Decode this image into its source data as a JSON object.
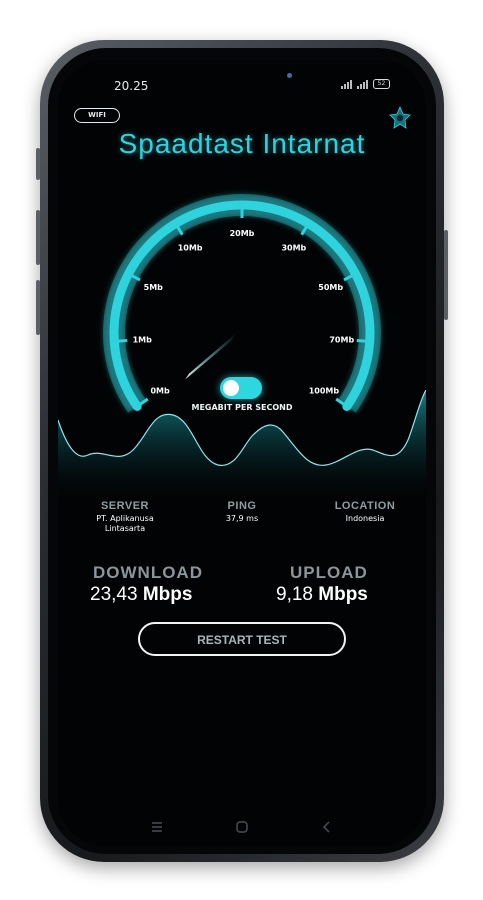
{
  "status_bar": {
    "time": "20.25",
    "battery": "52"
  },
  "header": {
    "network_badge": "WIFI",
    "title": "Spaadtast Intarnat",
    "settings_icon": "gear-icon"
  },
  "gauge": {
    "ticks": [
      "0Mb",
      "1Mb",
      "5Mb",
      "10Mb",
      "20Mb",
      "30Mb",
      "50Mb",
      "70Mb",
      "100Mb"
    ],
    "unit_label": "MEGABIT PER SECOND",
    "needle_value_mb": 0.7,
    "accent_color": "#2fd3de",
    "toggle_on": true
  },
  "info": {
    "server": {
      "label": "SERVER",
      "value_line1": "PT. Aplikanusa",
      "value_line2": "Lintasarta"
    },
    "ping": {
      "label": "PING",
      "value": "37,9 ms"
    },
    "location": {
      "label": "LOCATION",
      "value": "Indonesia"
    }
  },
  "results": {
    "download": {
      "label": "DOWNLOAD",
      "value": "23,43",
      "unit": "Mbps"
    },
    "upload": {
      "label": "UPLOAD",
      "value": "9,18",
      "unit": "Mbps"
    }
  },
  "actions": {
    "restart_label": "RESTART TEST"
  },
  "nav": [
    "menu-icon",
    "home-icon",
    "back-icon"
  ]
}
